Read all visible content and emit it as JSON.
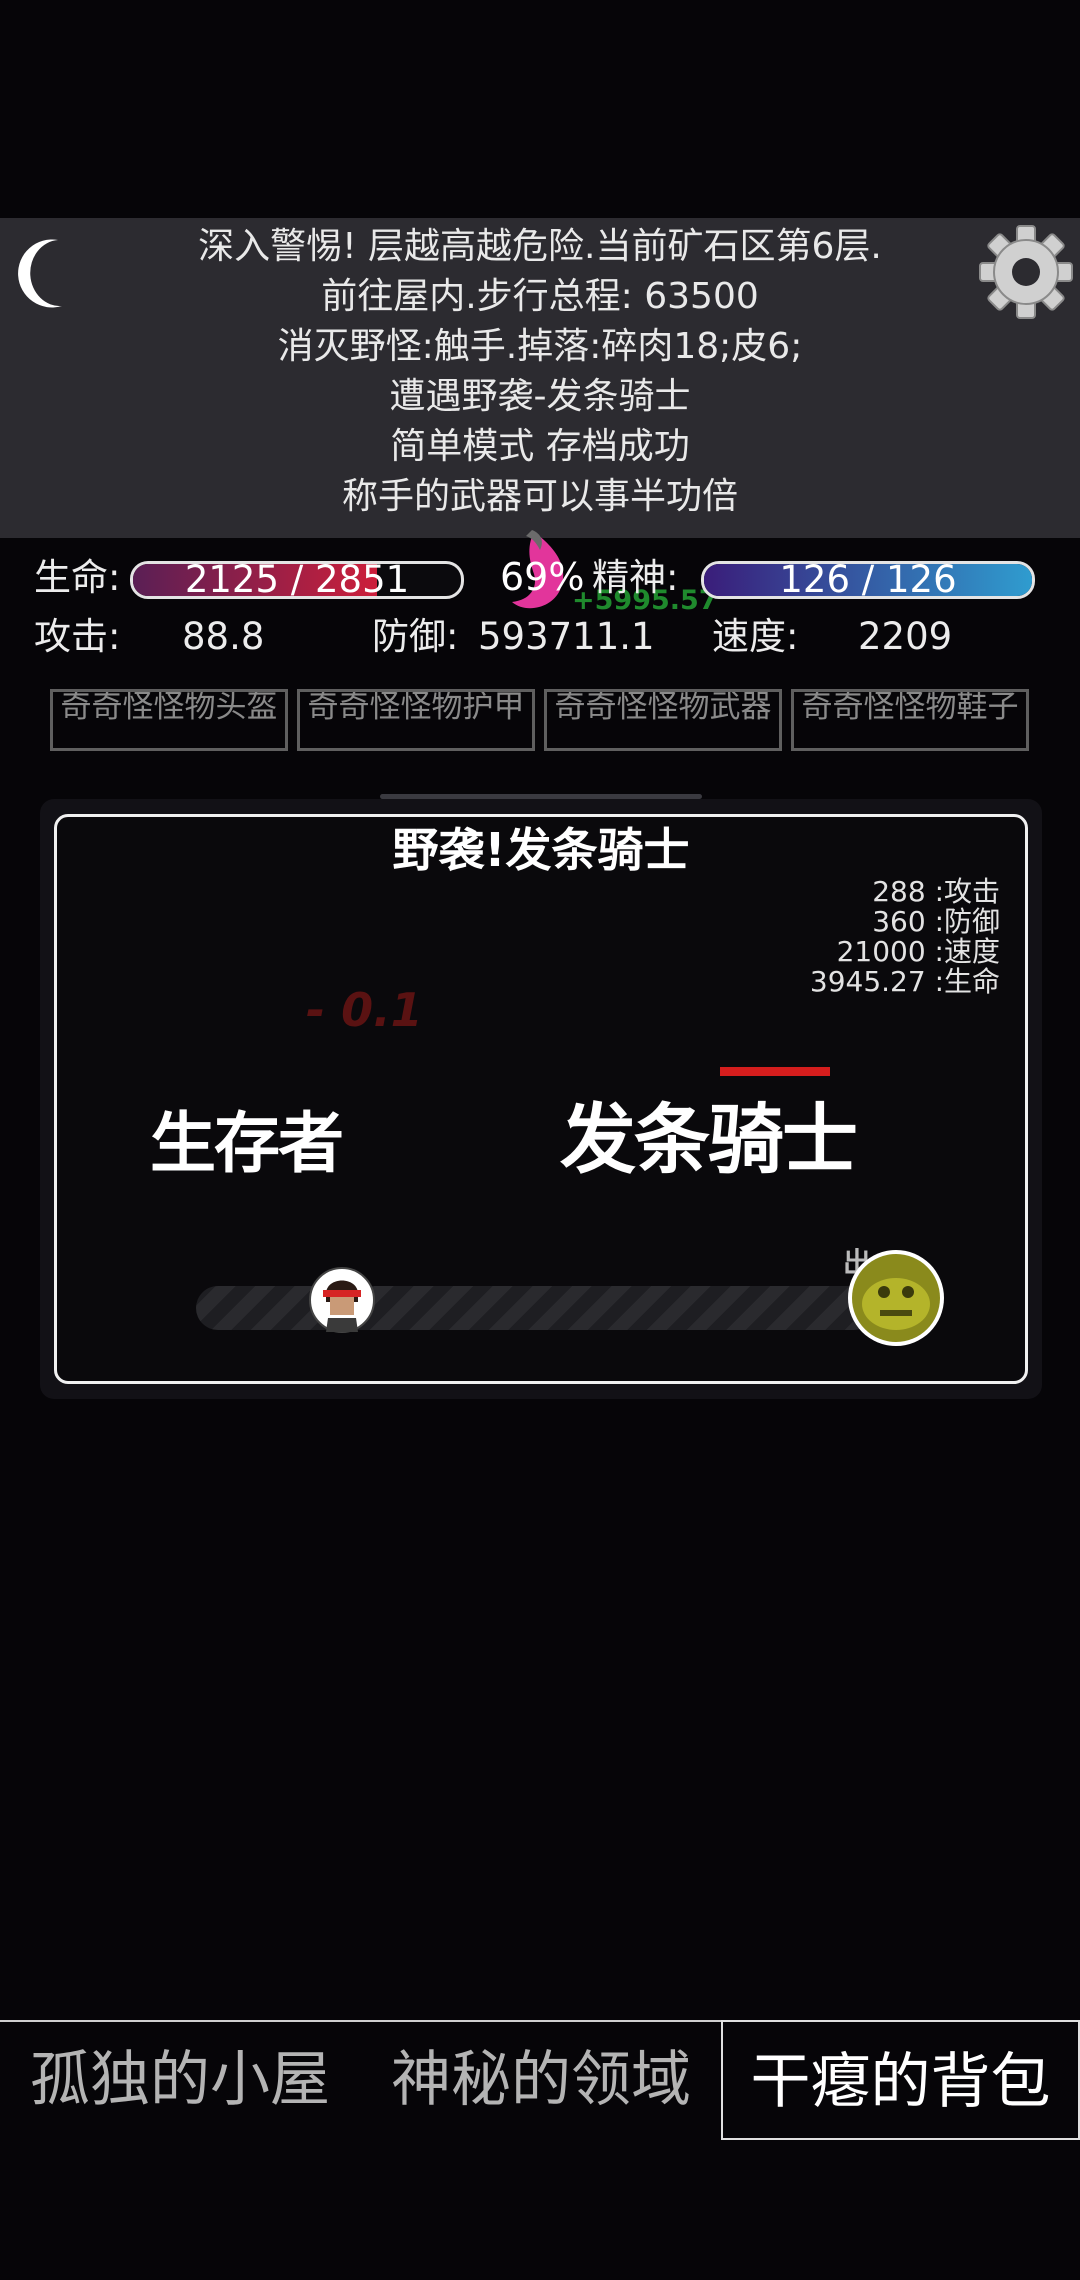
{
  "log": {
    "lines": [
      "深入警惕! 层越高越危险.当前矿石区第6层.",
      "前往屋内.步行总程: 63500",
      "消灭野怪:触手.掉落:碎肉18;皮6;",
      "遭遇野袭-发条骑士",
      "简单模式 存档成功",
      "称手的武器可以事半功倍"
    ]
  },
  "stats": {
    "hp_label": "生命:",
    "hp_text": "2125 / 2851",
    "hp_fraction": 0.745,
    "center_percent": "69%",
    "gain_text": "+5995.57",
    "spirit_label": "精神:",
    "spirit_text": "126 / 126",
    "spirit_fraction": 1.0,
    "attack_label": "攻击:",
    "attack_value": "88.8",
    "defense_label": "防御:",
    "defense_value": "593711.1",
    "speed_label": "速度:",
    "speed_value": "2209"
  },
  "equipment": [
    "奇奇怪怪物头盔",
    "奇奇怪怪物护甲",
    "奇奇怪怪物武器",
    "奇奇怪怪物鞋子"
  ],
  "battle": {
    "title": "野袭!发条骑士",
    "enemy_stats": [
      "288 :攻击",
      "360 :防御",
      "21000 :速度",
      "3945.27 :生命"
    ],
    "damage_text": "- 0.1",
    "player_name": "生存者",
    "enemy_name": "发条骑士",
    "enemy_hp_fraction": 1.0,
    "marker_text": "出",
    "colors": {
      "enemy_hp": "#d51d1d",
      "damage": "#5a1212"
    }
  },
  "nav": {
    "tabs": [
      "孤独的小屋",
      "神秘的领域",
      "干瘪的背包"
    ],
    "active_index": 2
  },
  "colors": {
    "hp_fill": "#cc1f3b",
    "spirit_fill": "#2f9ccf",
    "gain": "#1f8a2d",
    "background": "#060508",
    "panel": "#2c2b30"
  }
}
